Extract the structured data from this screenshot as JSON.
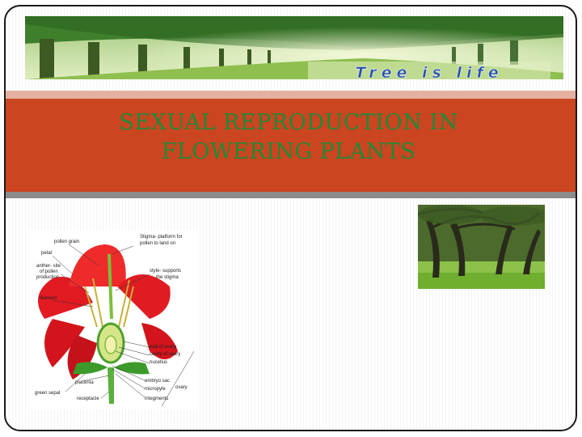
{
  "banner": {
    "text": "Tree is life"
  },
  "title": {
    "line1": "SEXUAL REPRODUCTION IN",
    "line2": "FLOWERING PLANTS"
  },
  "diagram": {
    "labels": {
      "pollen_grain": "pollen grain",
      "stigma": "Stigma- platform for",
      "stigma2": "pollen to land on",
      "petal": "petal",
      "anther": "anther- site",
      "anther2": "of pollen",
      "anther3": "production",
      "style": "style- supports",
      "style2": "the stigma",
      "filament": "filament",
      "wall_of_ovary": "wall of ovary",
      "cavity_of_ovary": "cavity of ovary",
      "nucellus": "nucellus",
      "placenta": "placenta",
      "embryo_sac": "embryo sac",
      "micropyle": "micropyle",
      "ovary": "ovary",
      "green_sepal": "green sepal",
      "receptacle": "receptacle",
      "integments": "integments"
    }
  },
  "colors": {
    "title_band": "#cb4521",
    "title_text": "#1f8a36"
  }
}
